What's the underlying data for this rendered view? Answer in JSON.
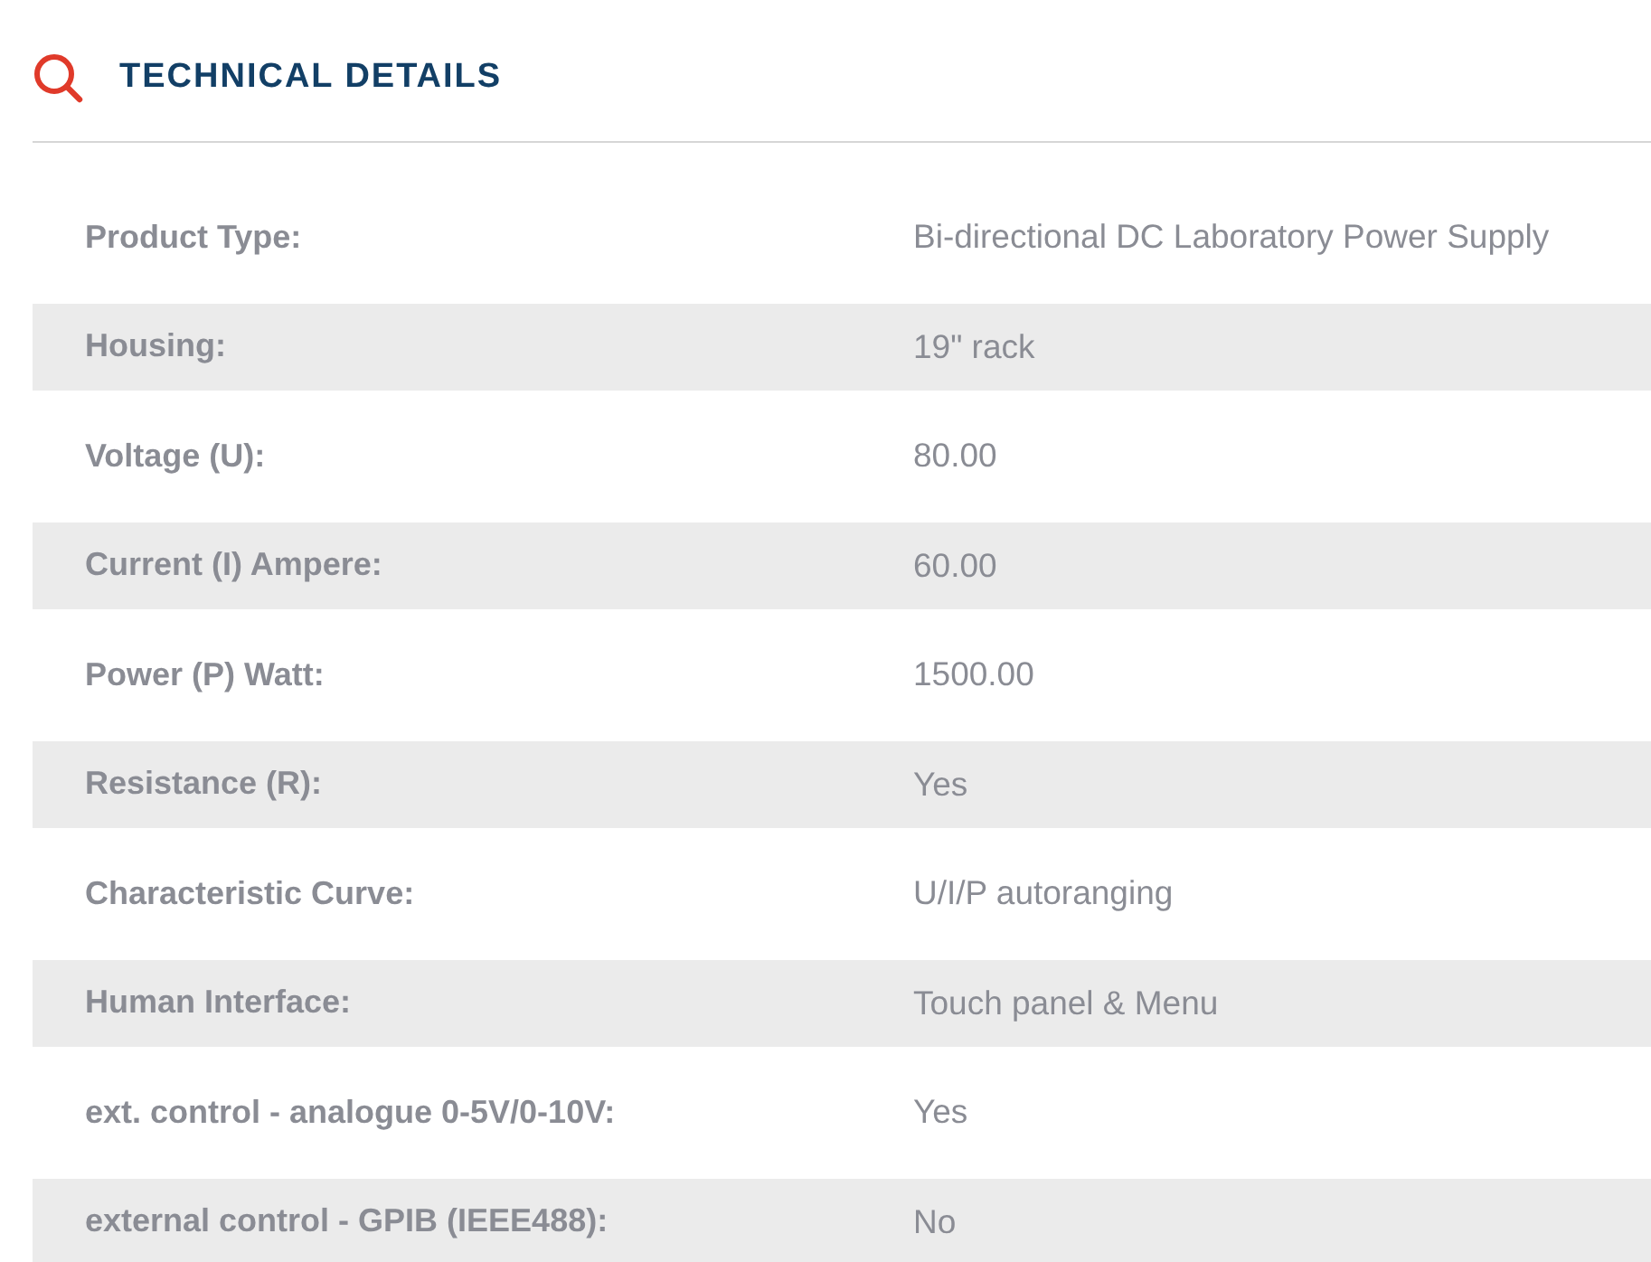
{
  "section": {
    "title": "TECHNICAL DETAILS"
  },
  "rows": [
    {
      "label": "Product Type:",
      "value": "Bi-directional DC Laboratory Power Supply"
    },
    {
      "label": "Housing:",
      "value": "19\" rack"
    },
    {
      "label": "Voltage (U):",
      "value": "80.00"
    },
    {
      "label": "Current (I) Ampere:",
      "value": "60.00"
    },
    {
      "label": "Power (P) Watt:",
      "value": "1500.00"
    },
    {
      "label": "Resistance (R):",
      "value": "Yes"
    },
    {
      "label": "Characteristic Curve:",
      "value": "U/I/P autoranging"
    },
    {
      "label": "Human Interface:",
      "value": "Touch panel & Menu"
    },
    {
      "label": "ext. control - analogue 0-5V/0-10V:",
      "value": "Yes"
    },
    {
      "label": "external control - GPIB (IEEE488):",
      "value": "No"
    }
  ]
}
